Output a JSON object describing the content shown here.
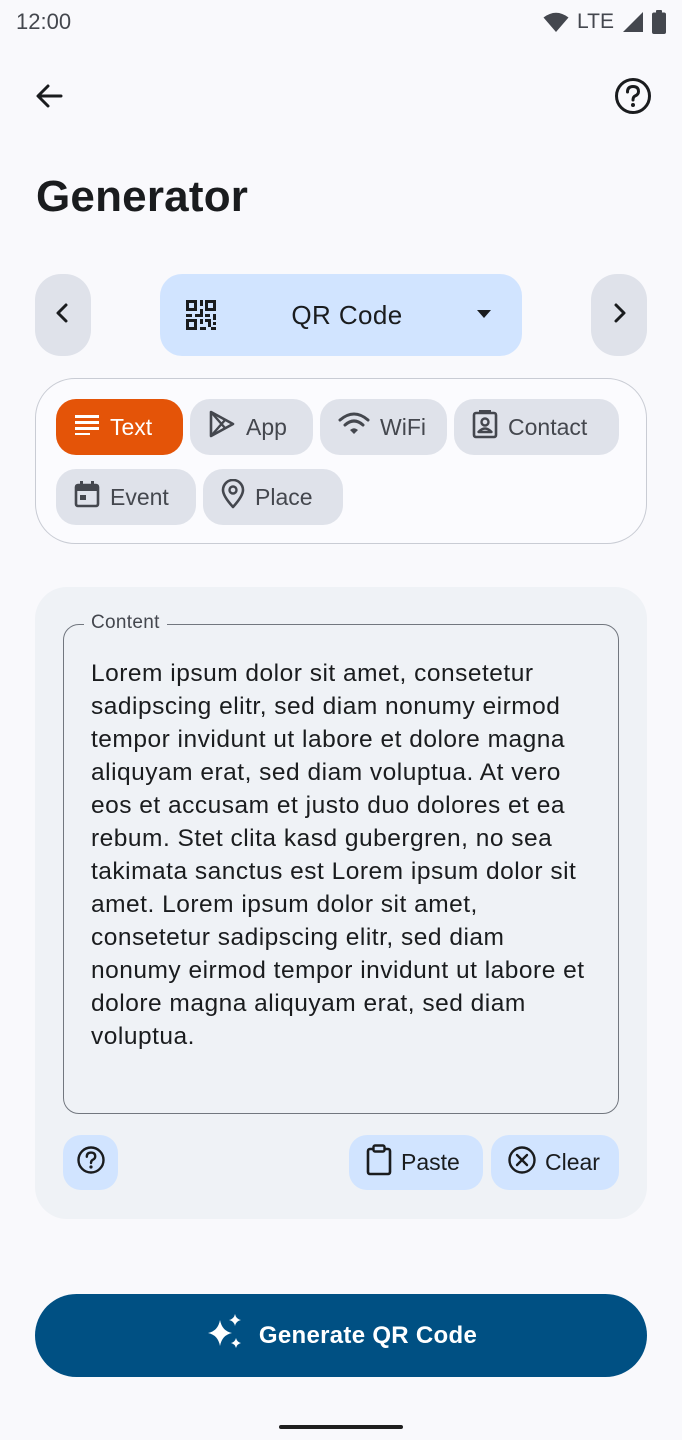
{
  "status_bar": {
    "time": "12:00",
    "network": "LTE",
    "icons": [
      "wifi-icon",
      "cell-signal-icon",
      "battery-icon"
    ]
  },
  "top_bar": {
    "back_icon": "arrow-back-icon",
    "help_icon": "help-circle-icon"
  },
  "page": {
    "title": "Generator"
  },
  "code_type": {
    "prev_icon": "chevron-left-icon",
    "next_icon": "chevron-right-icon",
    "selected_icon": "qr-code-icon",
    "selected_label": "QR Code",
    "dropdown_icon": "caret-down-icon"
  },
  "content_types": [
    {
      "label": "Text",
      "icon": "text-lines-icon",
      "selected": true
    },
    {
      "label": "App",
      "icon": "play-store-icon",
      "selected": false
    },
    {
      "label": "WiFi",
      "icon": "wifi-icon",
      "selected": false
    },
    {
      "label": "Contact",
      "icon": "contact-card-icon",
      "selected": false
    },
    {
      "label": "Event",
      "icon": "calendar-icon",
      "selected": false
    },
    {
      "label": "Place",
      "icon": "location-pin-icon",
      "selected": false
    }
  ],
  "content": {
    "field_label": "Content",
    "value": "Lorem ipsum dolor sit amet, consetetur sadipscing elitr, sed diam nonumy eirmod tempor invidunt ut labore et dolore magna aliquyam erat, sed diam voluptua. At vero eos et accusam et justo duo dolores et ea rebum. Stet clita kasd gubergren, no sea takimata sanctus est Lorem ipsum dolor sit amet. Lorem ipsum dolor sit amet, consetetur sadipscing elitr, sed diam nonumy eirmod tempor invidunt ut labore et dolore magna aliquyam erat, sed diam voluptua.",
    "paste_label": "Paste",
    "clear_label": "Clear"
  },
  "generate": {
    "label": "Generate QR Code",
    "icon": "sparkle-icon"
  },
  "colors": {
    "accent_selected": "#e45408",
    "primary": "#005083",
    "secondary_container": "#d1e4ff",
    "chip_bg": "#dfe2ea"
  }
}
